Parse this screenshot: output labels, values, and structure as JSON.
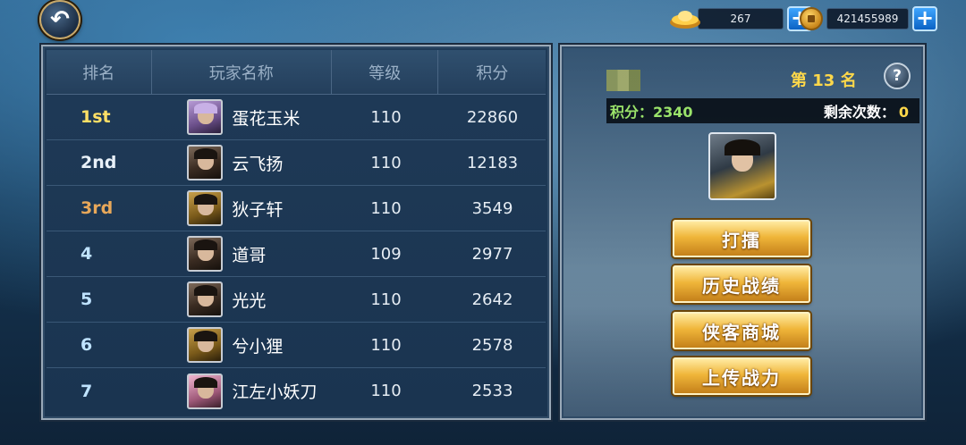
{
  "currency": {
    "ingot_amount": "267",
    "coin_amount": "421455989",
    "plus_label": "+"
  },
  "back_label": "↶",
  "leaderboard": {
    "headers": [
      "排名",
      "玩家名称",
      "等级",
      "积分"
    ],
    "rows": [
      {
        "rank": "1st",
        "name": "蛋花玉米",
        "level": "110",
        "score": "22860"
      },
      {
        "rank": "2nd",
        "name": "云飞扬",
        "level": "110",
        "score": "12183"
      },
      {
        "rank": "3rd",
        "name": "狄子轩",
        "level": "110",
        "score": "3549"
      },
      {
        "rank": "4",
        "name": "道哥",
        "level": "109",
        "score": "2977"
      },
      {
        "rank": "5",
        "name": "光光",
        "level": "110",
        "score": "2642"
      },
      {
        "rank": "6",
        "name": "兮小狸",
        "level": "110",
        "score": "2578"
      },
      {
        "rank": "7",
        "name": "江左小妖刀",
        "level": "110",
        "score": "2533"
      }
    ]
  },
  "player": {
    "rank_text": "第 13 名",
    "score_text": "积分：2340",
    "remain_label": "剩余次数：",
    "remain_value": "0",
    "help_label": "?"
  },
  "actions": {
    "challenge": "打擂",
    "history": "历史战绩",
    "shop": "侠客商城",
    "upload": "上传战力"
  },
  "colors": {
    "rank_gold": "#ffe066",
    "rank_silver": "#e8f0f8",
    "rank_bronze": "#e8a85a",
    "player_score": "#9ae36a",
    "player_rank": "#ffd84a"
  }
}
